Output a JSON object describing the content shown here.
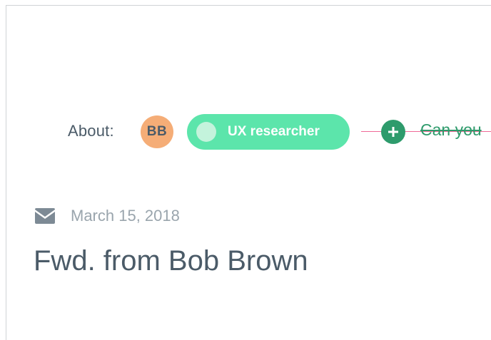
{
  "about": {
    "label": "About:",
    "avatar_initials": "BB",
    "tag_label": "UX researcher",
    "tag_color": "#5ce5ab",
    "avatar_color": "#f5ad77",
    "add_icon": "plus-icon",
    "task_text": "Can you"
  },
  "email": {
    "icon": "mail-icon",
    "date": "March 15, 2018",
    "title": "Fwd. from Bob Brown"
  },
  "colors": {
    "text_primary": "#4b5b68",
    "text_muted": "#9aa5ad",
    "accent_green": "#2e9b6c",
    "strike_pink": "#ef6a97"
  }
}
